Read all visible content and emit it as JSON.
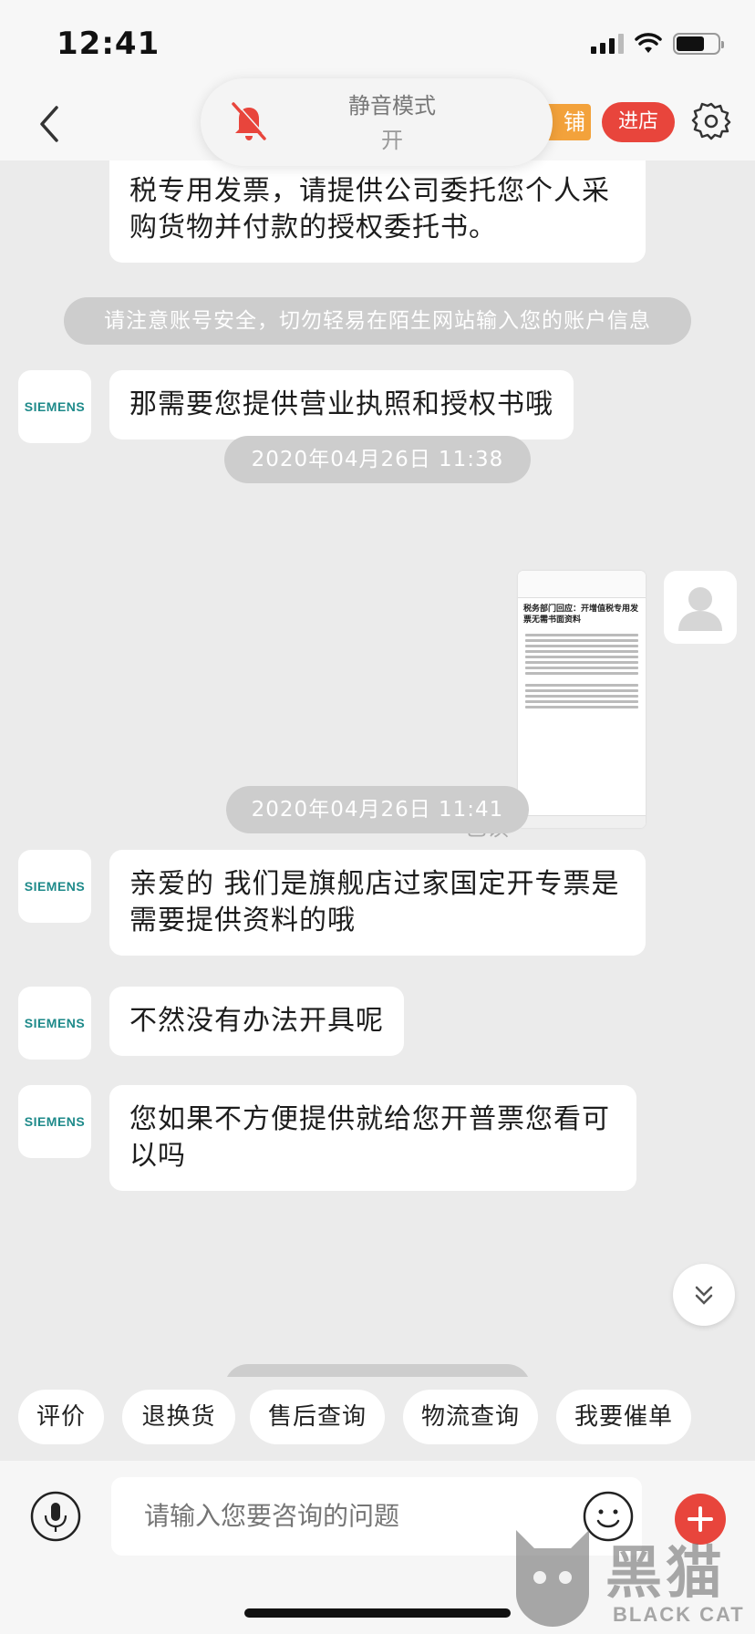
{
  "status_bar": {
    "time": "12:41",
    "battery_level": 0.68
  },
  "nav": {
    "shop_tag": "铺",
    "enter_label": "进店",
    "mute_popup": {
      "title": "静音模式",
      "state": "开"
    }
  },
  "messages": {
    "m0": "税专用发票，请提供公司委托您个人采购货物并付款的授权委托书。",
    "notice": "请注意账号安全，切勿轻易在陌生网站输入您的账户信息",
    "m1": "那需要您提供营业执照和授权书哦",
    "time1": "2020年04月26日 11:38",
    "read_label": "已读",
    "image_title": "税务部门回应：开增值税专用发票无需书面资料",
    "time2": "2020年04月26日 11:41",
    "m2": "亲爱的 我们是旗舰店过家国定开专票是需要提供资料的哦",
    "m3": "不然没有办法开具呢",
    "m4": "您如果不方便提供就给您开普票您看可以吗",
    "brand": "SIEMENS"
  },
  "quick_replies": [
    "评价",
    "退换货",
    "售后查询",
    "物流查询",
    "我要催单"
  ],
  "input": {
    "placeholder": "请输入您要咨询的问题"
  },
  "watermark": {
    "cn": "黑猫",
    "en": "BLACK CAT"
  },
  "colors": {
    "accent_red": "#e8453c",
    "shop_orange": "#f3a23b",
    "siemens_teal": "#1e8a8a"
  }
}
